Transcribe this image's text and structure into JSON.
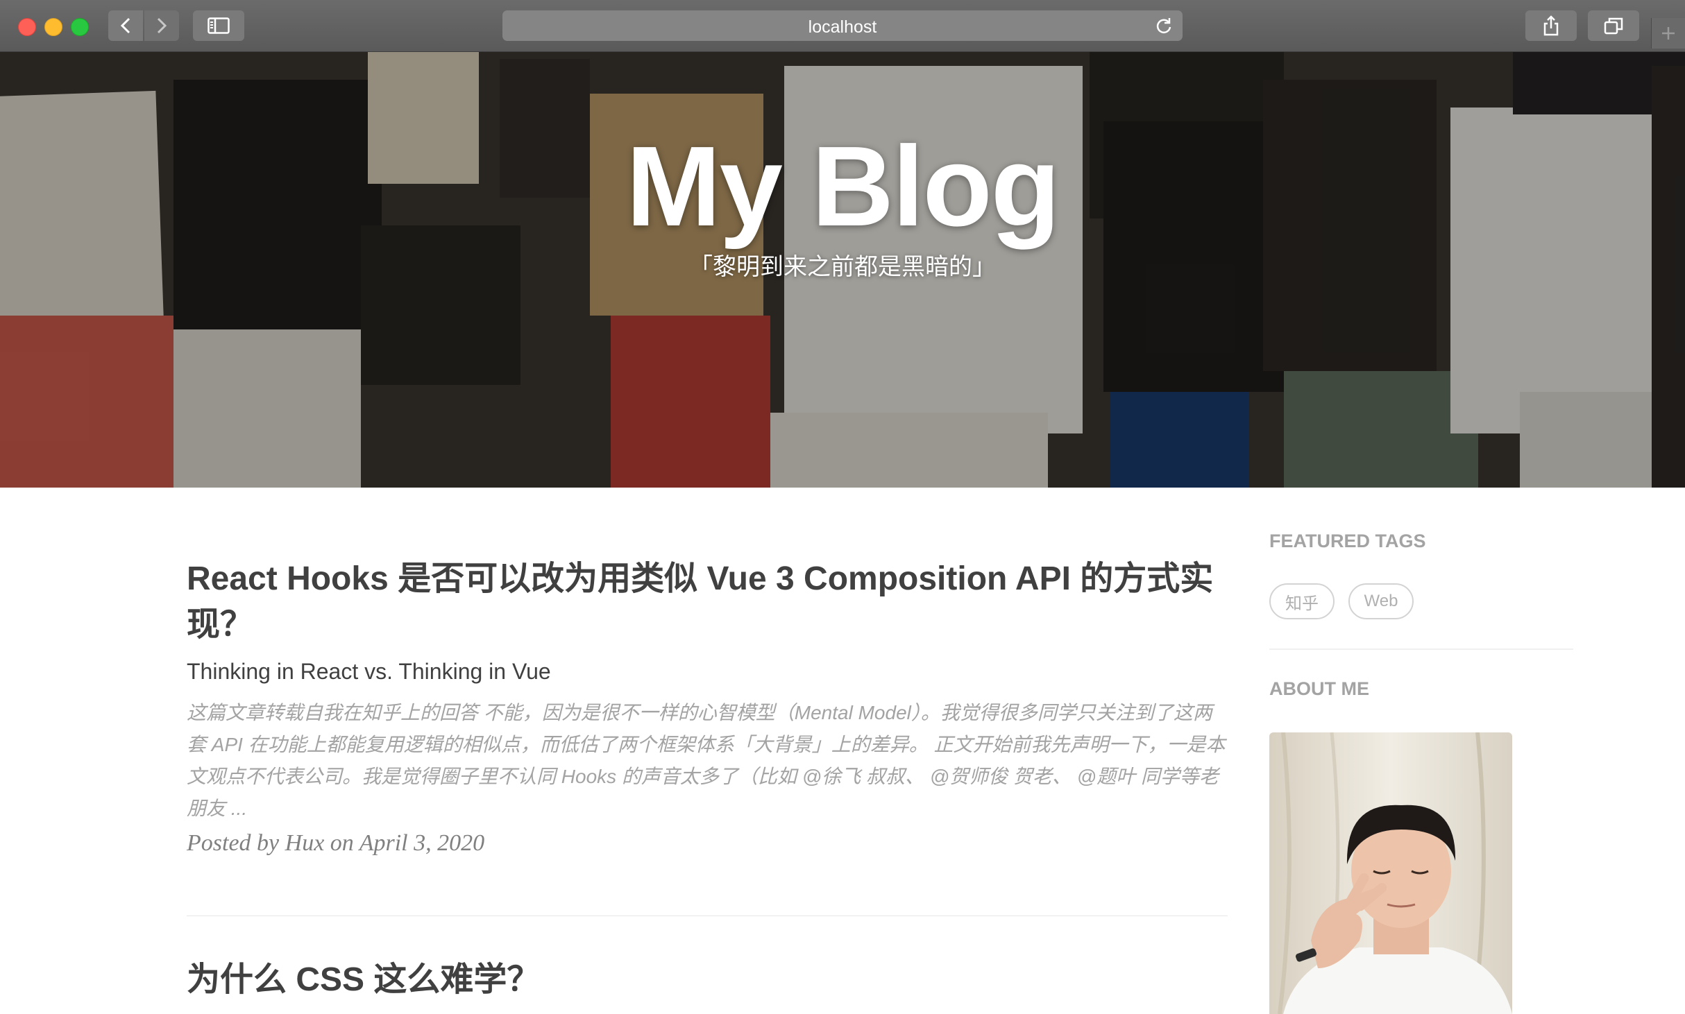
{
  "browser": {
    "url": "localhost",
    "icons": {
      "back": "chevron-left-icon",
      "forward": "chevron-right-icon",
      "sidebar": "sidebar-icon",
      "reload": "reload-icon",
      "share": "share-icon",
      "tabs": "tabs-overview-icon",
      "new_tab": "plus-icon"
    }
  },
  "hero": {
    "title": "My Blog",
    "subtitle": "「黎明到来之前都是黑暗的」"
  },
  "posts": [
    {
      "title": "React Hooks 是否可以改为用类似 Vue 3 Composition API 的方式实现？",
      "subtitle": "Thinking in React vs. Thinking in Vue",
      "excerpt": "这篇文章转载自我在知乎上的回答 不能，因为是很不一样的心智模型（Mental Model）。我觉得很多同学只关注到了这两套 API 在功能上都能复用逻辑的相似点，而低估了两个框架体系「大背景」上的差异。 正文开始前我先声明一下，一是本文观点不代表公司。我是觉得圈子里不认同 Hooks 的声音太多了（比如 @徐飞 叔叔、 @贺师俊 贺老、 @题叶 同学等老朋友 ...",
      "meta_prefix": "Posted by",
      "author": "Hux",
      "meta_on": "on",
      "date": "April 3, 2020"
    },
    {
      "title": "为什么 CSS 这么难学？"
    }
  ],
  "sidebar": {
    "featured_tags_heading": "FEATURED TAGS",
    "tags": [
      "知乎",
      "Web"
    ],
    "about_heading": "ABOUT ME"
  },
  "colors": {
    "heading": "#404040",
    "muted": "#a3a3a3",
    "meta": "#808080"
  }
}
